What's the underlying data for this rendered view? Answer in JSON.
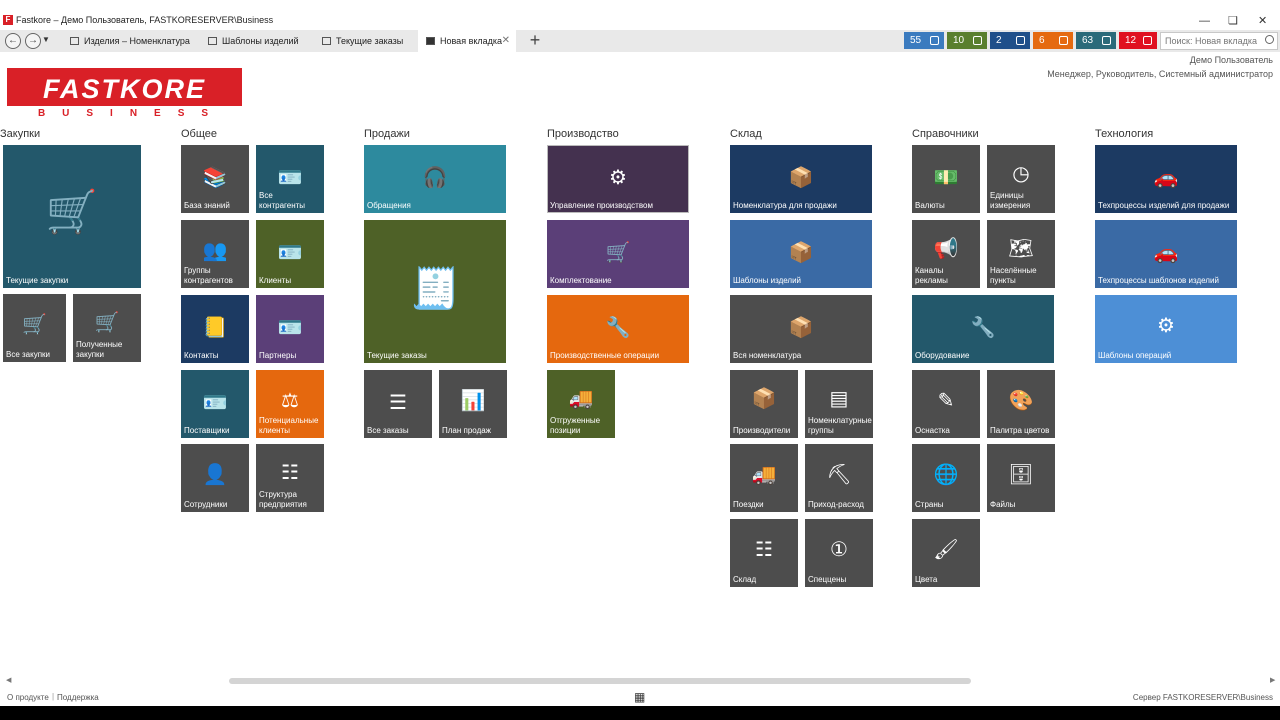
{
  "window": {
    "title": "Fastkore – Демо Пользователь, FASTKORESERVER\\Business",
    "app_icon": "F"
  },
  "tabs": [
    {
      "label": "Изделия – Номенклатура дл",
      "active": false
    },
    {
      "label": "Шаблоны изделий",
      "active": false
    },
    {
      "label": "Текущие заказы",
      "active": false
    },
    {
      "label": "Новая вкладка",
      "active": true
    }
  ],
  "badges": [
    {
      "count": "55",
      "icon": "calendar-icon",
      "color": "#3b7bbf"
    },
    {
      "count": "10",
      "icon": "money-icon",
      "color": "#5a7f2e"
    },
    {
      "count": "2",
      "icon": "cart-icon",
      "color": "#1f4f8a"
    },
    {
      "count": "6",
      "icon": "support-icon",
      "color": "#e56a10"
    },
    {
      "count": "63",
      "icon": "support-icon",
      "color": "#2a6a7a"
    },
    {
      "count": "12",
      "icon": "calendar-icon",
      "color": "#e01020"
    }
  ],
  "search": {
    "placeholder": "Поиск: Новая вкладка"
  },
  "logo": {
    "main": "FASTKORE",
    "sub": "BUSINESS"
  },
  "user": {
    "name": "Демо Пользователь",
    "roles": "Менеджер, Руководитель, Системный администратор"
  },
  "sections": {
    "purchases": "Закупки",
    "general": "Общее",
    "sales": "Продажи",
    "production": "Производство",
    "warehouse": "Склад",
    "references": "Справочники",
    "technology": "Технология"
  },
  "tiles": {
    "current_purchases": "Текущие закупки",
    "all_purchases": "Все закупки",
    "received_purchases": "Полученные закупки",
    "knowledge_base": "База знаний",
    "all_contractors": "Все контрагенты",
    "contractor_groups": "Группы контрагентов",
    "clients": "Клиенты",
    "contacts": "Контакты",
    "partners": "Партнеры",
    "suppliers": "Поставщики",
    "potential_clients": "Потенциальные клиенты",
    "employees": "Сотрудники",
    "company_structure": "Структура предприятия",
    "inquiries": "Обращения",
    "current_orders": "Текущие заказы",
    "all_orders": "Все заказы",
    "sales_plan": "План продаж",
    "production_management": "Управление производством",
    "kitting": "Комплектование",
    "production_operations": "Производственные операции",
    "shipped_items": "Отгруженные позиции",
    "sale_nomenclature": "Номенклатура для продажи",
    "product_templates": "Шаблоны изделий",
    "all_nomenclature": "Вся номенклатура",
    "manufacturers": "Производители",
    "nomenclature_groups": "Номенклатурные группы",
    "trips": "Поездки",
    "income_expense": "Приход-расход",
    "warehouse": "Склад",
    "special_prices": "Спеццены",
    "currencies": "Валюты",
    "units": "Единицы измерения",
    "ad_channels": "Каналы рекламы",
    "settlements": "Населённые пункты",
    "equipment": "Оборудование",
    "tooling": "Оснастка",
    "color_palette": "Палитра цветов",
    "countries": "Страны",
    "files": "Файлы",
    "colors": "Цвета",
    "tp_sale_products": "Техпроцессы изделий для продажи",
    "tp_product_templates": "Техпроцессы шаблонов изделий",
    "operation_templates": "Шаблоны операций"
  },
  "footer": {
    "about": "О продукте",
    "support": "Поддержка",
    "server": "Сервер FASTKORESERVER\\Business"
  },
  "colors": {
    "logo_red": "#d92027",
    "gray_tile": "#4d4d4d",
    "teal": "#23586b",
    "olive": "#4e6127",
    "purple": "#5b3f78",
    "orange": "#e5680e",
    "navy": "#1c3a62",
    "blue": "#3a6aa5",
    "lightblue": "#4d8fd6"
  }
}
